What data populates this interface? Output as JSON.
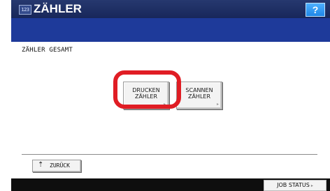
{
  "window": {
    "title": "ZÄHLER",
    "title_icon_text": "123",
    "help_label": "?"
  },
  "main": {
    "section_heading": "ZÄHLER GESAMT",
    "buttons": [
      {
        "label_line1": "DRUCKEN",
        "label_line2": "ZÄHLER",
        "highlighted": true
      },
      {
        "label_line1": "SCANNEN",
        "label_line2": "ZÄHLER",
        "highlighted": false
      }
    ],
    "highlight_color": "#e01d24"
  },
  "footer": {
    "back_label": "ZURÜCK",
    "back_icon": "up-arrow-icon",
    "job_status_label": "JOB STATUS"
  },
  "colors": {
    "titlebar": "#1c2c62",
    "band": "#1e3a9a",
    "bottombar": "#0e0e0e",
    "help_button": "#2d9bf0"
  }
}
